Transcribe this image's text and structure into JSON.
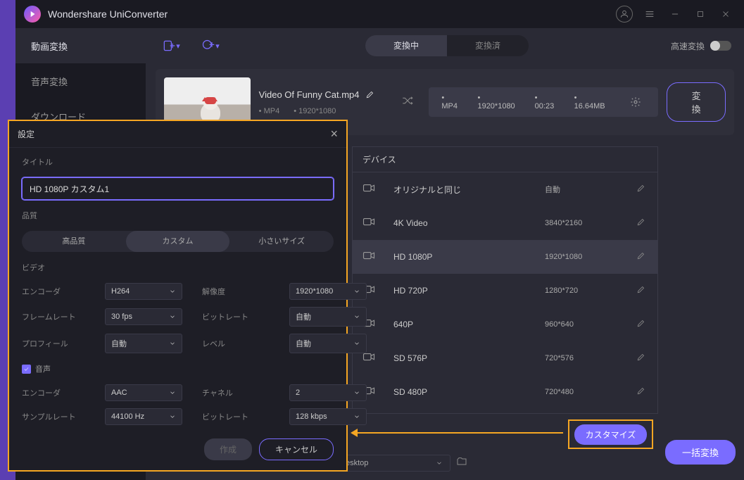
{
  "app": {
    "title": "Wondershare UniConverter"
  },
  "sidebar": {
    "items": [
      {
        "label": "動画変換"
      },
      {
        "label": "音声変換"
      },
      {
        "label": "ダウンロード"
      }
    ]
  },
  "topbar": {
    "tabs": {
      "converting": "変換中",
      "converted": "変換済"
    },
    "speed_label": "高速変換"
  },
  "media": {
    "name": "Video Of Funny Cat.mp4",
    "src_format": "MP4",
    "src_res": "1920*1080",
    "dest_format": "MP4",
    "dest_res": "1920*1080",
    "duration": "00:23",
    "size": "16.64MB",
    "convert_label": "変換"
  },
  "device_panel": {
    "header": "デバイス",
    "rows": [
      {
        "label": "オリジナルと同じ",
        "res": "自動"
      },
      {
        "label": "4K Video",
        "res": "3840*2160"
      },
      {
        "label": "HD 1080P",
        "res": "1920*1080"
      },
      {
        "label": "HD 720P",
        "res": "1280*720"
      },
      {
        "label": "640P",
        "res": "960*640"
      },
      {
        "label": "SD 576P",
        "res": "720*576"
      },
      {
        "label": "SD 480P",
        "res": "720*480"
      }
    ]
  },
  "customize_label": "カスタマイズ",
  "batch_label": "一括変換",
  "settings": {
    "header": "設定",
    "title_label": "タイトル",
    "title_value": "HD 1080P カスタム1",
    "quality_label": "品質",
    "quality_options": {
      "high": "高品質",
      "custom": "カスタム",
      "small": "小さいサイズ"
    },
    "video_label": "ビデオ",
    "video": {
      "encoder_label": "エンコーダ",
      "encoder": "H264",
      "resolution_label": "解像度",
      "resolution": "1920*1080",
      "framerate_label": "フレームレート",
      "framerate": "30 fps",
      "bitrate_label": "ビットレート",
      "bitrate": "自動",
      "profile_label": "プロフィール",
      "profile": "自動",
      "level_label": "レベル",
      "level": "自動"
    },
    "audio_label": "音声",
    "audio": {
      "encoder_label": "エンコーダ",
      "encoder": "AAC",
      "channel_label": "チャネル",
      "channel": "2",
      "samplerate_label": "サンプルレート",
      "samplerate": "44100 Hz",
      "bitrate_label": "ビットレート",
      "bitrate": "128 kbps"
    },
    "create_label": "作成",
    "cancel_label": "キャンセル"
  },
  "folder": {
    "path": "esktop"
  },
  "bullet": "•"
}
